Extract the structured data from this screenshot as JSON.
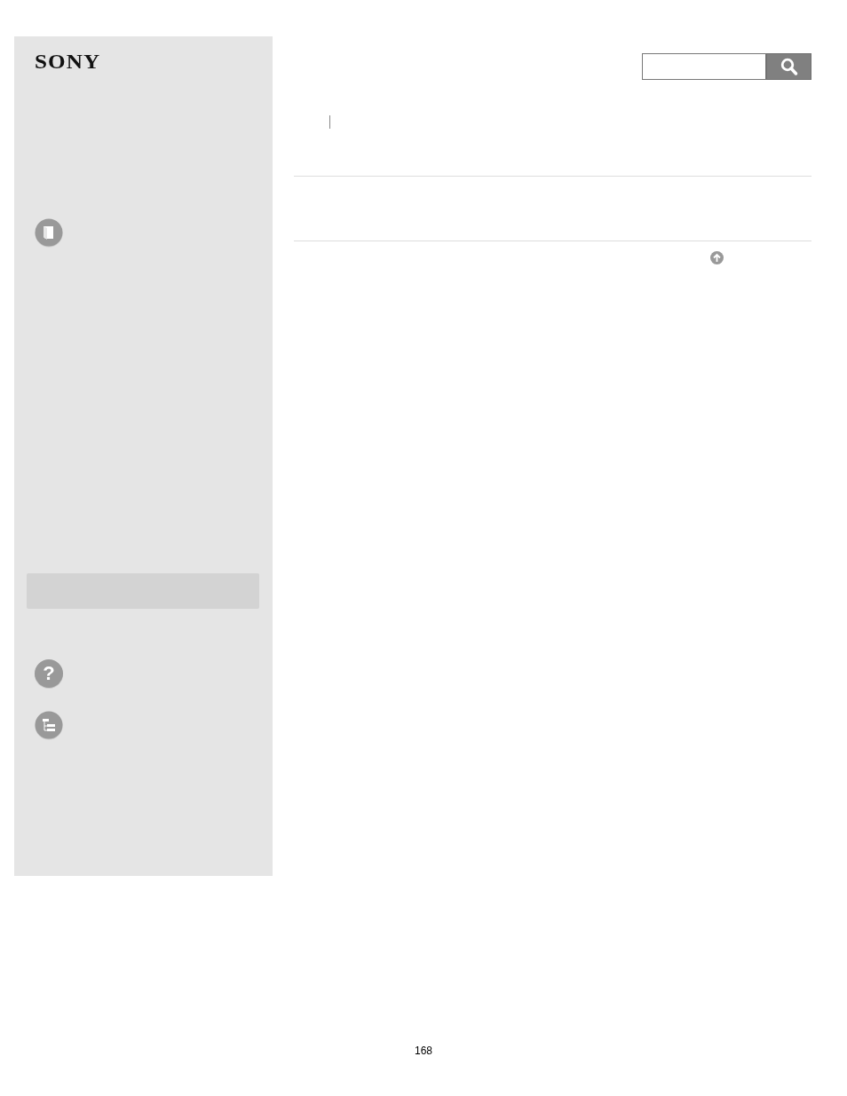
{
  "logo": "SONY",
  "sidebar": {
    "icons": [
      {
        "kind": "book"
      },
      {
        "kind": "spacer_bar"
      },
      {
        "kind": "help",
        "glyph": "?"
      },
      {
        "kind": "tree"
      }
    ]
  },
  "page_number": "168"
}
